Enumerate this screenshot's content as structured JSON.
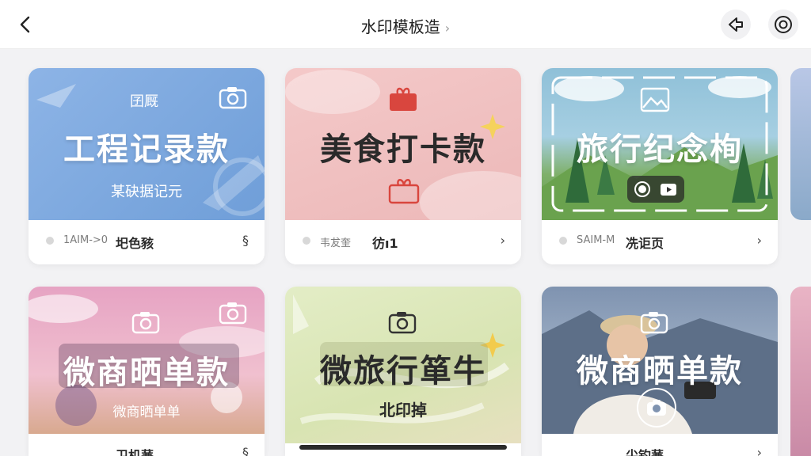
{
  "header": {
    "title": "水印模板造",
    "chevron": "›",
    "back_icon": "chevron-left-icon",
    "share_icon": "share-icon",
    "settings_icon": "record-icon"
  },
  "cards": [
    {
      "tag": "囝厩",
      "title": "工程记录款",
      "subtitle": "某砄据记元",
      "meta": "1AIM->0",
      "label": "圯色豥",
      "more": "§"
    },
    {
      "tag": "",
      "title": "美食打卡款",
      "subtitle": "",
      "meta": "韦犮奎",
      "label": "彷ı1",
      "more": "›"
    },
    {
      "tag": "",
      "title": "旅行纪念栒",
      "subtitle": "",
      "meta": "SAIM-M",
      "label": "冼讵页",
      "more": "›"
    },
    {
      "tag": "",
      "title": "微商晒单款",
      "subtitle": "微商晒单单",
      "meta": "",
      "label": "卫机蒹",
      "more": "§"
    },
    {
      "tag": "",
      "title": "微旅行箪牛",
      "subtitle": "北印掉",
      "meta": "",
      "label": "",
      "more": ""
    },
    {
      "tag": "",
      "title": "微商晒单款",
      "subtitle": "",
      "meta": "",
      "label": "尖钓蒹",
      "more": "›"
    }
  ],
  "colors": {
    "accent_blue": "#7ea8dc",
    "accent_pink": "#f0c4c4",
    "accent_green": "#9cbf8b"
  }
}
